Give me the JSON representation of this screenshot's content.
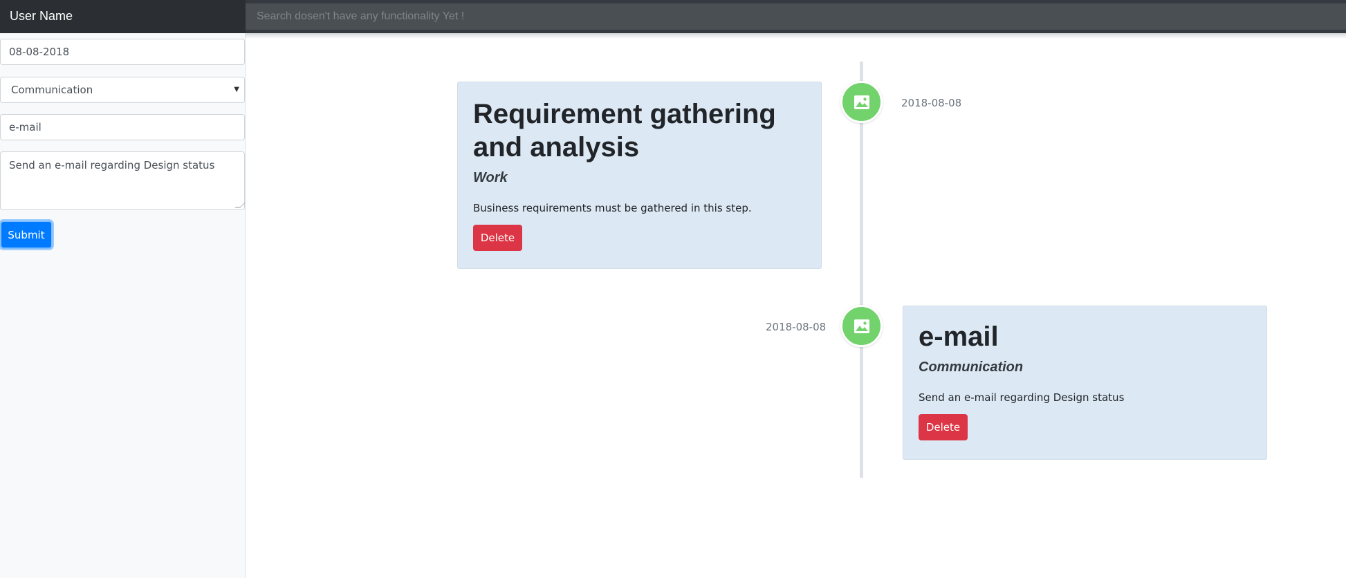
{
  "header": {
    "user_name": "User Name",
    "search_placeholder": "Search dosen't have any functionality Yet !"
  },
  "form": {
    "date_value": "08-08-2018",
    "category_selected": "Communication",
    "title_value": "e-mail",
    "description_value": "Send an e-mail regarding Design status",
    "submit_label": "Submit"
  },
  "timeline": {
    "items": [
      {
        "date": "2018-08-08",
        "title": "Requirement gathering and analysis",
        "category": "Work",
        "description": "Business requirements must be gathered in this step.",
        "delete_label": "Delete",
        "icon": "image-icon"
      },
      {
        "date": "2018-08-08",
        "title": "e-mail",
        "category": "Communication",
        "description": "Send an e-mail regarding Design status",
        "delete_label": "Delete",
        "icon": "image-icon"
      }
    ]
  },
  "colors": {
    "topbar": "#343a40",
    "marker": "#72d26c",
    "card": "#dce8f3",
    "delete": "#dc3545",
    "submit": "#007bff"
  }
}
